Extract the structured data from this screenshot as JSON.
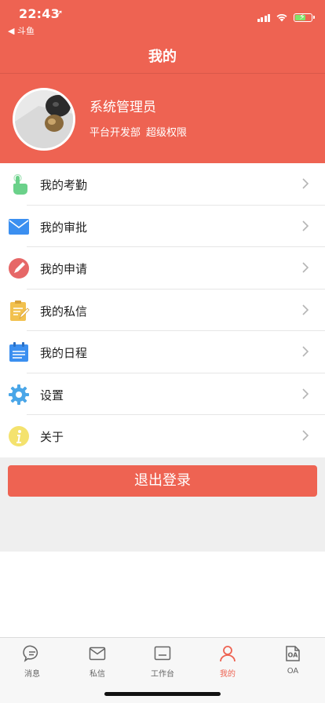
{
  "status_bar": {
    "time": "22:43",
    "location_arrow": "➚",
    "back_app": "◀ 斗鱼"
  },
  "nav": {
    "title": "我的"
  },
  "profile": {
    "name": "系统管理员",
    "department": "平台开发部",
    "role": "超级权限"
  },
  "menu": [
    {
      "label": "我的考勤",
      "icon": "hand-pointer-icon"
    },
    {
      "label": "我的审批",
      "icon": "envelope-icon"
    },
    {
      "label": "我的申请",
      "icon": "pen-icon"
    },
    {
      "label": "我的私信",
      "icon": "clipboard-icon"
    },
    {
      "label": "我的日程",
      "icon": "calendar-icon"
    },
    {
      "label": "设置",
      "icon": "gear-icon"
    },
    {
      "label": "关于",
      "icon": "info-icon"
    }
  ],
  "logout": {
    "label": "退出登录"
  },
  "tabs": [
    {
      "label": "消息",
      "icon": "chat-bubble-icon",
      "active": false
    },
    {
      "label": "私信",
      "icon": "mail-icon",
      "active": false
    },
    {
      "label": "工作台",
      "icon": "desk-icon",
      "active": false
    },
    {
      "label": "我的",
      "icon": "person-icon",
      "active": true
    },
    {
      "label": "OA",
      "icon": "oa-icon",
      "active": false
    }
  ],
  "colors": {
    "brand": "#ee6352",
    "active_tab": "#ee6352",
    "divider": "#e6e6e6"
  }
}
